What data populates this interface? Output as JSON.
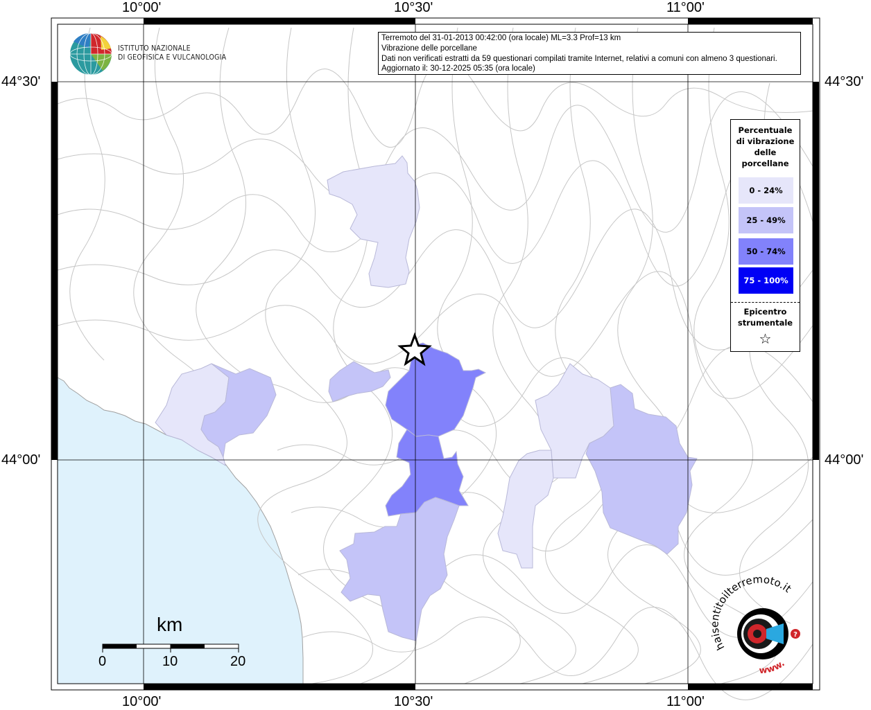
{
  "axes": {
    "top": [
      "10°00'",
      "10°30'",
      "11°00'"
    ],
    "bottom": [
      "10°00'",
      "10°30'",
      "11°00'"
    ],
    "left": [
      "44°30'",
      "44°00'"
    ],
    "right": [
      "44°30'",
      "44°00'"
    ]
  },
  "logo": {
    "line1": "ISTITUTO NAZIONALE",
    "line2": "DI GEOFISICA E VULCANOLOGIA"
  },
  "info": {
    "line1": "Terremoto del 31-01-2013 00:42:00 (ora locale) ML=3.3 Prof=13 km",
    "line2": "Vibrazione delle porcellane",
    "line3": "Dati non verificati estratti da 59 questionari compilati tramite Internet, relativi a comuni con almeno 3 questionari.",
    "line4": "Aggiornato il: 30-12-2025 05:35 (ora locale)"
  },
  "legend": {
    "title_lines": [
      "Percentuale",
      "di vibrazione",
      "delle",
      "porcellane"
    ],
    "items": [
      {
        "label": "0 - 24%",
        "color": "#e6e6fa",
        "text_color": "#000000"
      },
      {
        "label": "25 - 49%",
        "color": "#c4c4f8",
        "text_color": "#000000"
      },
      {
        "label": "50 - 74%",
        "color": "#8282fb",
        "text_color": "#000000"
      },
      {
        "label": "75 - 100%",
        "color": "#0000f5",
        "text_color": "#ffffff"
      }
    ],
    "epicenter_lines": [
      "Epicentro",
      "strumentale"
    ],
    "epicenter_symbol": "☆"
  },
  "scale": {
    "unit": "km",
    "ticks": [
      "0",
      "10",
      "20"
    ]
  },
  "colors": {
    "sea": "#dff2fc",
    "land": "#ffffff",
    "boundary": "#c8c8c8",
    "grid": "#000000"
  },
  "watermark": {
    "text_top": "haisentitoilterremoto.it",
    "text_bottom": "www."
  }
}
